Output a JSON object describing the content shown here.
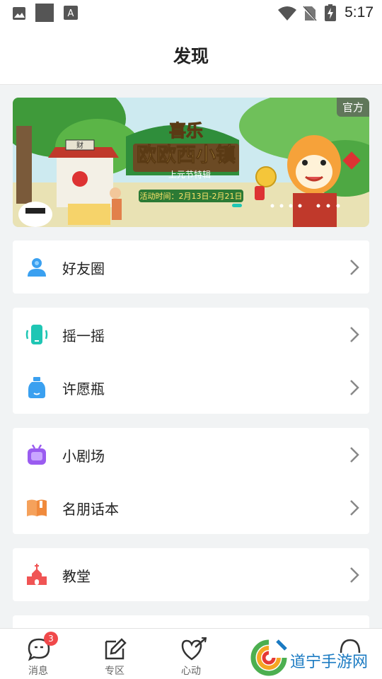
{
  "status_bar": {
    "time": "5:17"
  },
  "header": {
    "title": "发现"
  },
  "banner": {
    "badge": "官方",
    "title_line1": "喜乐",
    "title_line2": "欧欧西小镇",
    "subtitle": "上元节特辑",
    "date_text": "活动时间：2月13日-2月21日",
    "sign_text": "财"
  },
  "menu_groups": [
    {
      "items": [
        {
          "label": "好友圈",
          "icon": "friends-icon"
        }
      ]
    },
    {
      "items": [
        {
          "label": "摇一摇",
          "icon": "shake-icon"
        },
        {
          "label": "许愿瓶",
          "icon": "wish-bottle-icon"
        }
      ]
    },
    {
      "items": [
        {
          "label": "小剧场",
          "icon": "theater-icon"
        },
        {
          "label": "名朋话本",
          "icon": "storybook-icon"
        }
      ]
    },
    {
      "items": [
        {
          "label": "教堂",
          "icon": "church-icon"
        }
      ]
    }
  ],
  "tabbar": {
    "tabs": [
      {
        "label": "消息",
        "badge": "3"
      },
      {
        "label": "专区"
      },
      {
        "label": "心动"
      }
    ]
  },
  "watermark": {
    "text": "道宁手游网"
  },
  "colors": {
    "accent_teal": "#1fc6b4",
    "friends_blue": "#3aa0f0",
    "purple": "#9a5cf0",
    "orange": "#f5a15b",
    "red": "#f05454",
    "badge_red": "#f0484a"
  }
}
